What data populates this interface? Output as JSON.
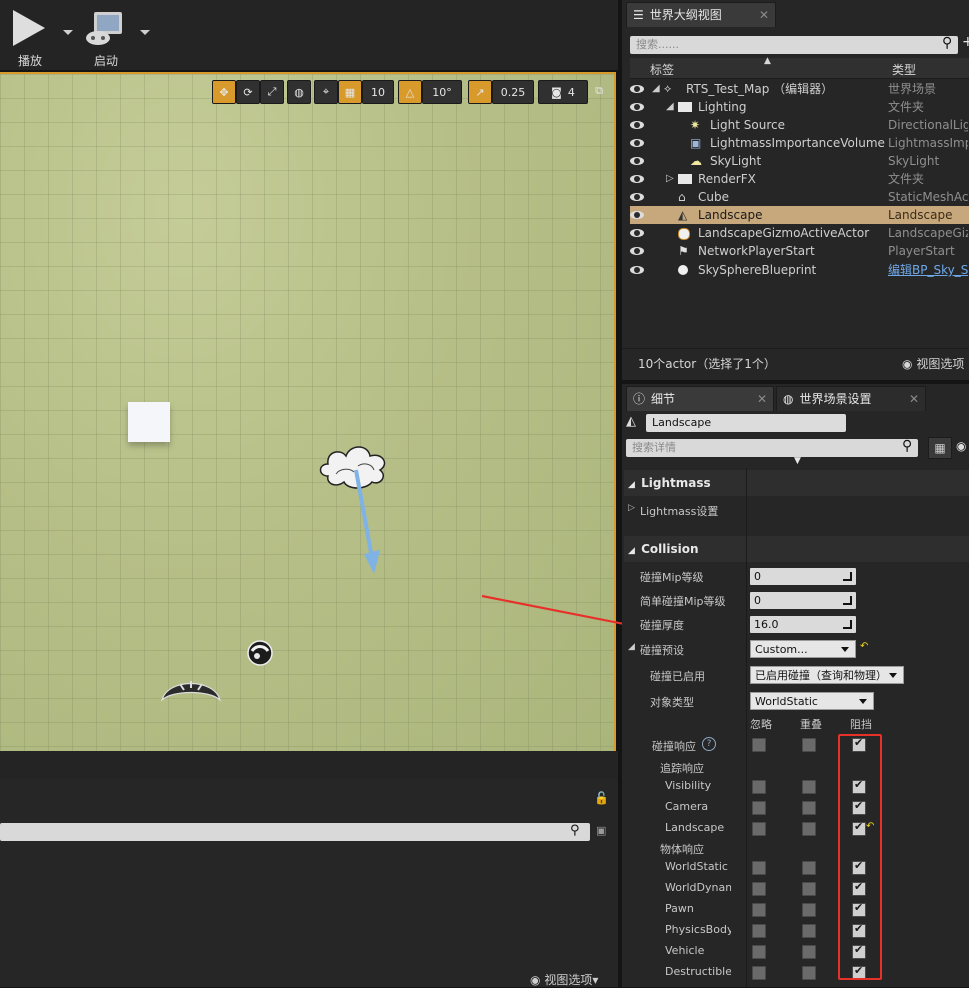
{
  "toolbar": {
    "play_label": "播放",
    "launch_label": "启动"
  },
  "viewport": {
    "grid_size": "10",
    "rotation_snap": "10°",
    "scale_snap": "0.25",
    "camera_speed": "4"
  },
  "bottom_panel": {
    "view_options_label": "视图选项"
  },
  "outliner": {
    "tab_title": "世界大纲视图",
    "search_placeholder": "搜索......",
    "col_label": "标签",
    "col_type": "类型",
    "rows": [
      {
        "name": "RTS_Test_Map （编辑器）",
        "type": "世界场景"
      },
      {
        "name": "Lighting",
        "type": "文件夹"
      },
      {
        "name": "Light Source",
        "type": "DirectionalLight"
      },
      {
        "name": "LightmassImportanceVolume",
        "type": "LightmassImportanceVolume"
      },
      {
        "name": "SkyLight",
        "type": "SkyLight"
      },
      {
        "name": "RenderFX",
        "type": "文件夹"
      },
      {
        "name": "Cube",
        "type": "StaticMeshActor"
      },
      {
        "name": "Landscape",
        "type": "Landscape"
      },
      {
        "name": "LandscapeGizmoActiveActor",
        "type": "LandscapeGizmoActiveActor"
      },
      {
        "name": "NetworkPlayerStart",
        "type": "PlayerStart"
      },
      {
        "name": "SkySphereBlueprint",
        "type": "编辑BP_Sky_Sphere"
      }
    ],
    "footer_count": "10个actor（选择了1个）",
    "view_options_label": "视图选项"
  },
  "details": {
    "tab_details": "细节",
    "tab_world_settings": "世界场景设置",
    "actor_name": "Landscape",
    "search_placeholder": "搜索详情",
    "lightmass_category": "Lightmass",
    "lightmass_settings": "Lightmass设置",
    "collision_category": "Collision",
    "props": {
      "collision_mip_level_label": "碰撞Mip等级",
      "collision_mip_level_value": "0",
      "simple_collision_mip_label": "简单碰撞Mip等级",
      "simple_collision_mip_value": "0",
      "collision_thickness_label": "碰撞厚度",
      "collision_thickness_value": "16.0",
      "collision_preset_label": "碰撞预设",
      "collision_preset_value": "Custom...",
      "collision_enabled_label": "碰撞已启用",
      "collision_enabled_value": "已启用碰撞（查询和物理）",
      "object_type_label": "对象类型",
      "object_type_value": "WorldStatic"
    },
    "response_headers": {
      "ignore": "忽略",
      "overlap": "重叠",
      "block": "阻挡"
    },
    "collision_responses_label": "碰撞响应",
    "trace_responses_label": "追踪响应",
    "object_responses_label": "物体响应",
    "trace_channels": [
      {
        "name": "Visibility",
        "ignore": false,
        "overlap": false,
        "block": true
      },
      {
        "name": "Camera",
        "ignore": false,
        "overlap": false,
        "block": true
      },
      {
        "name": "Landscape",
        "ignore": false,
        "overlap": false,
        "block": true
      }
    ],
    "object_channels": [
      {
        "name": "WorldStatic",
        "ignore": false,
        "overlap": false,
        "block": true
      },
      {
        "name": "WorldDynamic",
        "ignore": false,
        "overlap": false,
        "block": true
      },
      {
        "name": "Pawn",
        "ignore": false,
        "overlap": false,
        "block": true
      },
      {
        "name": "PhysicsBody",
        "ignore": false,
        "overlap": false,
        "block": true
      },
      {
        "name": "Vehicle",
        "ignore": false,
        "overlap": false,
        "block": true
      },
      {
        "name": "Destructible",
        "ignore": false,
        "overlap": false,
        "block": true
      }
    ]
  },
  "colors": {
    "accent_orange": "#d89a2a",
    "selection": "#c7a77c",
    "annotation_red": "#e8302a",
    "direction_arrow": "#7fb2e5"
  }
}
